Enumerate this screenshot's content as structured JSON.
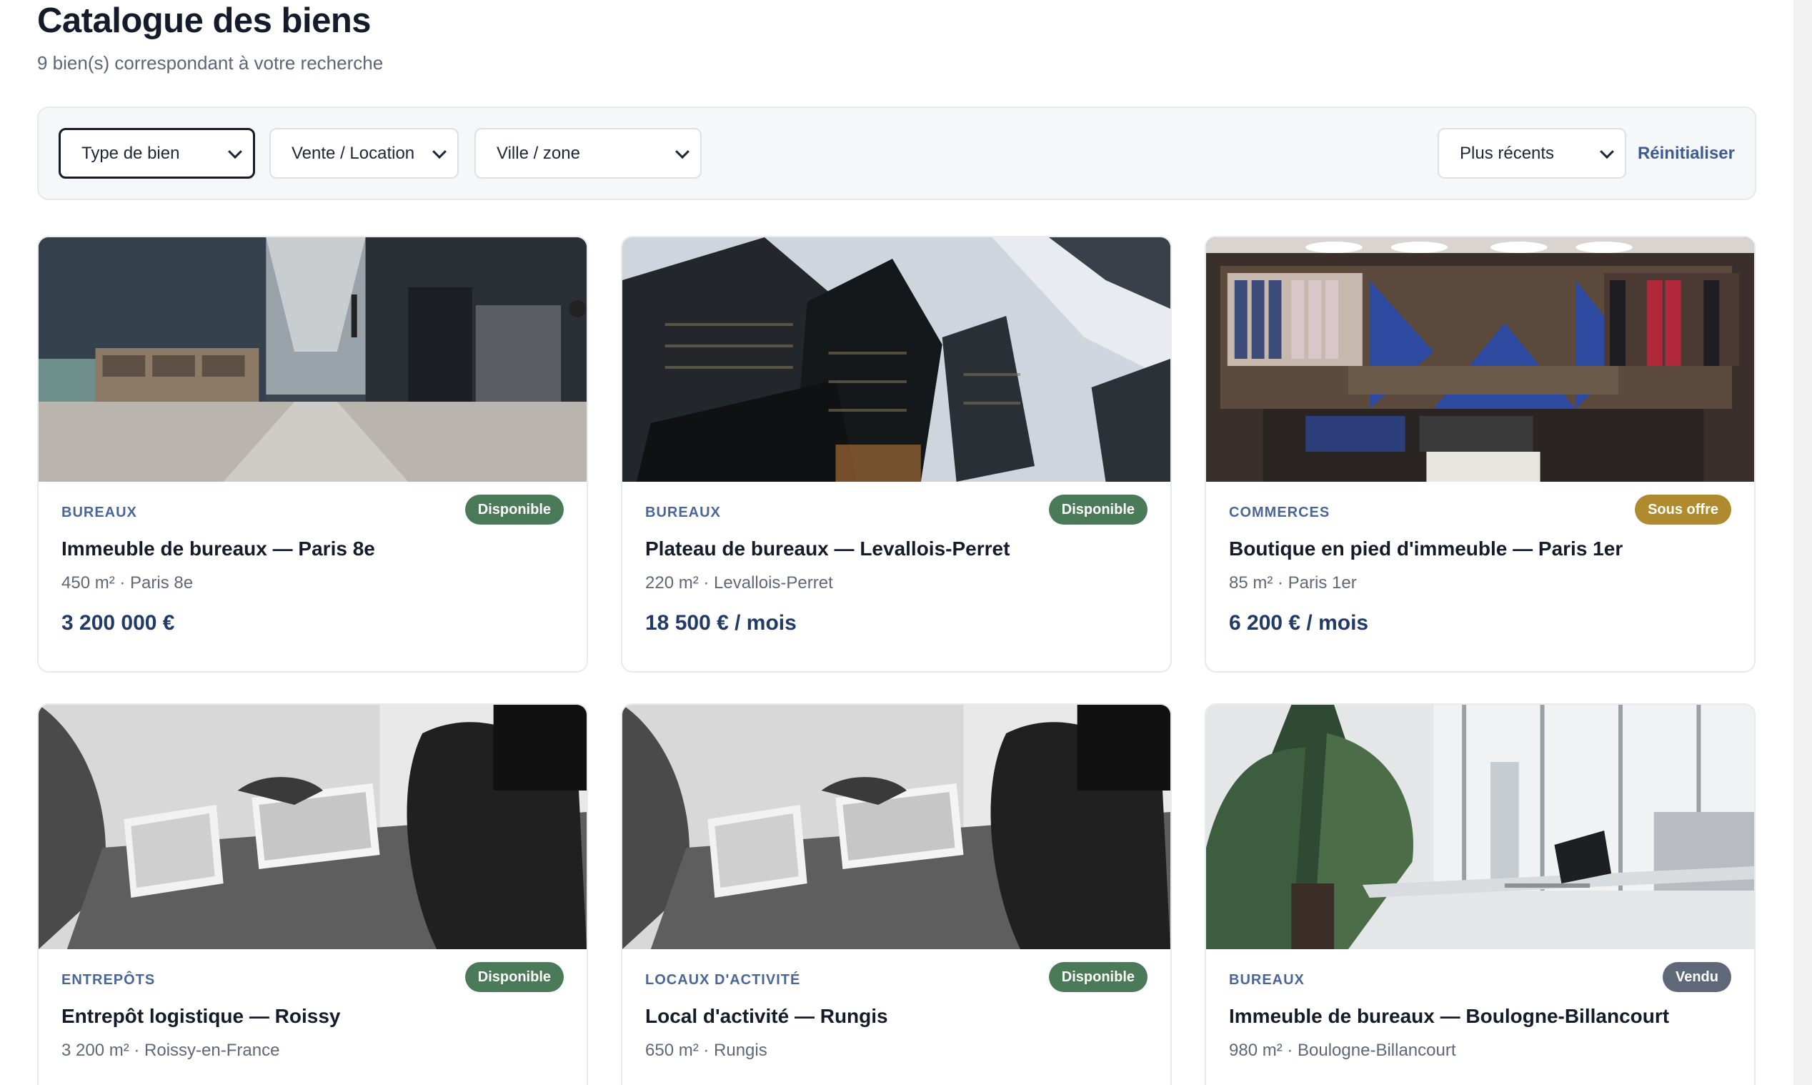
{
  "header": {
    "title": "Catalogue des biens",
    "subtitle": "9 bien(s) correspondant à votre recherche"
  },
  "filters": {
    "type": "Type de bien",
    "transaction": "Vente / Location",
    "city": "Ville / zone",
    "sort": "Plus récents",
    "reset": "Réinitialiser"
  },
  "listings": [
    {
      "type": "BUREAUX",
      "status": "Disponible",
      "status_color": "#4a7a58",
      "title": "Immeuble de bureaux — Paris 8e",
      "meta": "450 m² · Paris 8e",
      "price": "3 200 000 €",
      "photo_icon": "office-interior-photo"
    },
    {
      "type": "BUREAUX",
      "status": "Disponible",
      "status_color": "#4a7a58",
      "title": "Plateau de bureaux — Levallois-Perret",
      "meta": "220 m² · Levallois-Perret",
      "price": "18 500 € / mois",
      "photo_icon": "skyscrapers-photo"
    },
    {
      "type": "COMMERCES",
      "status": "Sous offre",
      "status_color": "#b08a2e",
      "title": "Boutique en pied d'immeuble — Paris 1er",
      "meta": "85 m² · Paris 1er",
      "price": "6 200 € / mois",
      "photo_icon": "clothing-store-photo"
    },
    {
      "type": "ENTREPÔTS",
      "status": "Disponible",
      "status_color": "#4a7a58",
      "title": "Entrepôt logistique — Roissy",
      "meta": "3 200 m² · Roissy-en-France",
      "price": "",
      "photo_icon": "laptops-meeting-photo"
    },
    {
      "type": "LOCAUX D'ACTIVITÉ",
      "status": "Disponible",
      "status_color": "#4a7a58",
      "title": "Local d'activité — Rungis",
      "meta": "650 m² · Rungis",
      "price": "",
      "photo_icon": "laptops-meeting-photo"
    },
    {
      "type": "BUREAUX",
      "status": "Vendu",
      "status_color": "#5f6878",
      "title": "Immeuble de bureaux — Boulogne-Billancourt",
      "meta": "980 m² · Boulogne-Billancourt",
      "price": "",
      "photo_icon": "office-window-plant-photo"
    }
  ]
}
